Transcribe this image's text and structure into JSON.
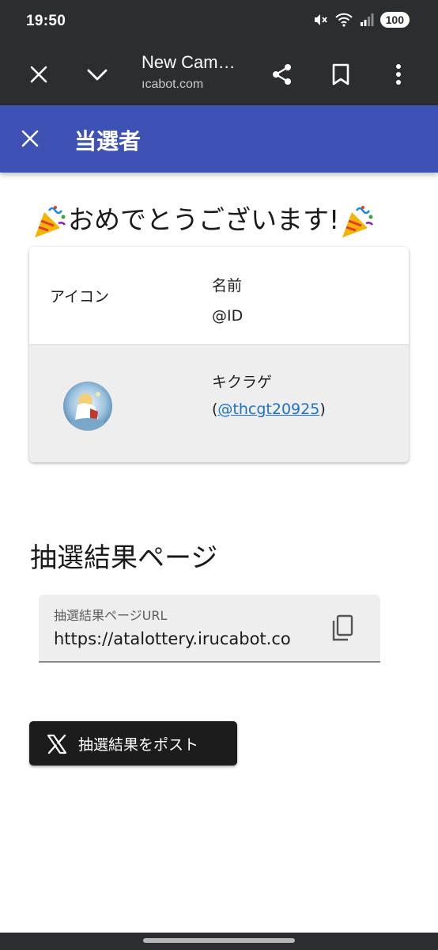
{
  "status_bar": {
    "time": "19:50",
    "battery": "100"
  },
  "browser": {
    "title": "New Cam…",
    "url": "ıcabot.com"
  },
  "header": {
    "title": "当選者"
  },
  "congrats": {
    "text": "おめでとうございます!"
  },
  "winners_table": {
    "col_icon": "アイコン",
    "col_name": "名前",
    "col_id": "@ID",
    "rows": [
      {
        "name": "キクラゲ",
        "id_prefix": "(",
        "id": "@thcgt20925",
        "id_suffix": ")"
      }
    ]
  },
  "result_section": {
    "title": "抽選結果ページ",
    "url_label": "抽選結果ページURL",
    "url_value": "https://atalottery.irucabot.co"
  },
  "post_button": {
    "label": "抽選結果をポスト"
  },
  "colors": {
    "header_bg": "#3e51b5",
    "chrome_bg": "#2c2d30",
    "link": "#1a73c8",
    "post_bg": "#1c1c1c"
  }
}
